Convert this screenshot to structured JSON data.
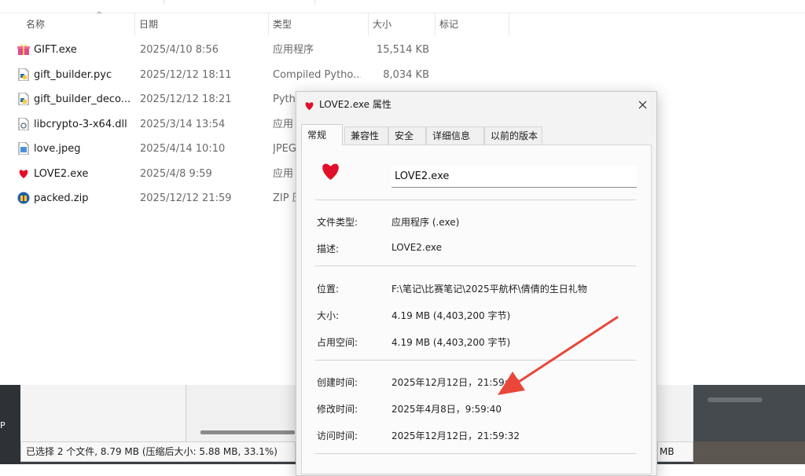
{
  "explorer": {
    "columns": [
      {
        "key": "name",
        "label": "名称"
      },
      {
        "key": "date",
        "label": "日期"
      },
      {
        "key": "type",
        "label": "类型"
      },
      {
        "key": "size",
        "label": "大小"
      },
      {
        "key": "tag",
        "label": "标记"
      }
    ],
    "sort_indicator": "^",
    "files": [
      {
        "name": "GIFT.exe",
        "date": "2025/4/10 8:56",
        "type": "应用程序",
        "size": "15,514 KB",
        "icon": "gift-icon"
      },
      {
        "name": "gift_builder.pyc",
        "date": "2025/12/12 18:11",
        "type": "Compiled Pytho...",
        "size": "8,034 KB",
        "icon": "python-file-icon"
      },
      {
        "name": "gift_builder_deco...",
        "date": "2025/12/12 18:21",
        "type": "Pytho",
        "size": "",
        "icon": "python-file-icon"
      },
      {
        "name": "libcrypto-3-x64.dll",
        "date": "2025/3/14 13:54",
        "type": "应用",
        "size": "",
        "icon": "dll-file-icon"
      },
      {
        "name": "love.jpeg",
        "date": "2025/4/14 10:10",
        "type": "JPEG",
        "size": "",
        "icon": "image-file-icon"
      },
      {
        "name": "LOVE2.exe",
        "date": "2025/4/8 9:59",
        "type": "应用",
        "size": "",
        "icon": "heart-icon"
      },
      {
        "name": "packed.zip",
        "date": "2025/12/12 21:59",
        "type": "ZIP 压",
        "size": "",
        "icon": "zip-file-icon"
      }
    ]
  },
  "dialog": {
    "title": "LOVE2.exe 属性",
    "tabs": [
      "常规",
      "兼容性",
      "安全",
      "详细信息",
      "以前的版本"
    ],
    "active_tab": 0,
    "file_name": "LOVE2.exe",
    "props": {
      "file_type_label": "文件类型:",
      "file_type_value": "应用程序 (.exe)",
      "description_label": "描述:",
      "description_value": "LOVE2.exe",
      "location_label": "位置:",
      "location_value": "F:\\笔记\\比赛笔记\\2025平航杯\\倩倩的生日礼物",
      "size_label": "大小:",
      "size_value": "4.19 MB (4,403,200 字节)",
      "disk_size_label": "占用空间:",
      "disk_size_value": "4.19 MB (4,403,200 字节)",
      "created_label": "创建时间:",
      "created_value": "2025年12月12日，21:59:32",
      "modified_label": "修改时间:",
      "modified_value": "2025年4月8日，9:59:40",
      "accessed_label": "访问时间:",
      "accessed_value": "2025年12月12日，21:59:32"
    }
  },
  "status": {
    "selection_text": "已选择 2 个文件, 8.79 MB (压缩后大小: 5.88 MB, 33.1%)",
    "right_fragment": "MB",
    "left_fragment": "P"
  },
  "colors": {
    "heart": "#e0102a",
    "annotation_arrow": "#e8473a"
  }
}
